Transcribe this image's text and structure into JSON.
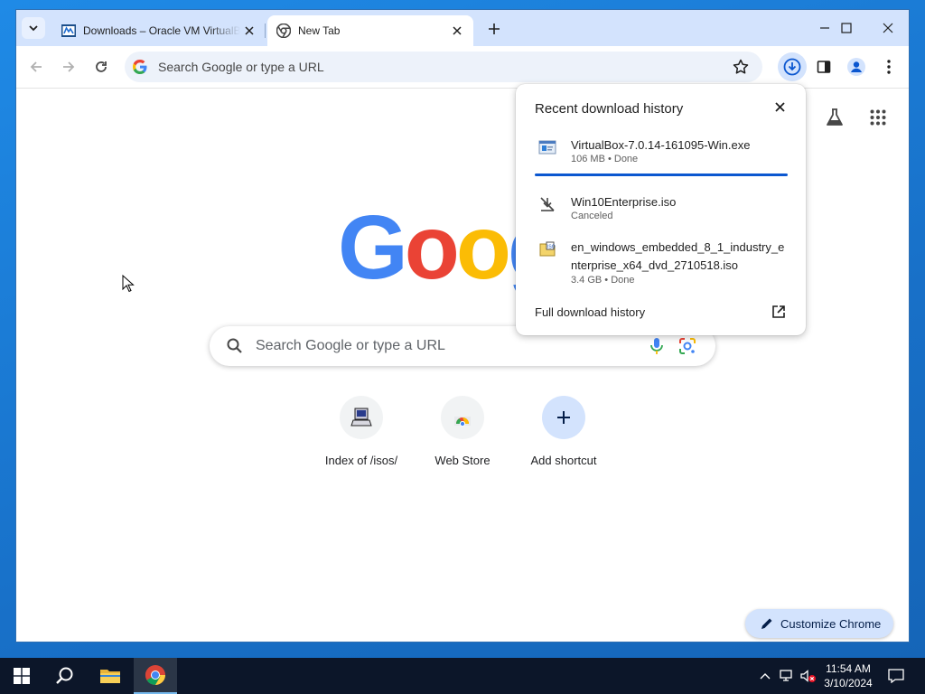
{
  "browser": {
    "tabs": [
      {
        "title": "Downloads – Oracle VM VirtualBox",
        "icon": "virtualbox-icon",
        "active": false
      },
      {
        "title": "New Tab",
        "icon": "chrome-icon",
        "active": true
      }
    ],
    "omnibox": {
      "placeholder": "Search Google or type a URL"
    }
  },
  "ntp": {
    "search_placeholder": "Search Google or type a URL",
    "shortcuts": [
      {
        "label": "Index of /isos/",
        "icon": "computer-icon"
      },
      {
        "label": "Web Store",
        "icon": "chrome-web-store-icon"
      },
      {
        "label": "Add shortcut",
        "icon": "plus-icon"
      }
    ],
    "customize_label": "Customize Chrome"
  },
  "download_bubble": {
    "title": "Recent download history",
    "items": [
      {
        "name": "VirtualBox-7.0.14-161095-Win.exe",
        "status": "106 MB • Done",
        "icon": "installer-file-icon"
      },
      {
        "name": "Win10Enterprise.iso",
        "status": "Canceled",
        "icon": "download-canceled-icon"
      },
      {
        "name": "en_windows_embedded_8_1_industry_enterprise_x64_dvd_2710518.iso",
        "status": "3.4 GB • Done",
        "icon": "iso-file-icon"
      }
    ],
    "full_history_label": "Full download history",
    "progress_fraction": 1.0
  },
  "taskbar": {
    "time": "11:54 AM",
    "date": "3/10/2024"
  },
  "colors": {
    "accent": "#0b57d0",
    "tabstrip": "#d3e3fd",
    "taskbar": "#0c1629",
    "desktop": "#1871c9"
  }
}
